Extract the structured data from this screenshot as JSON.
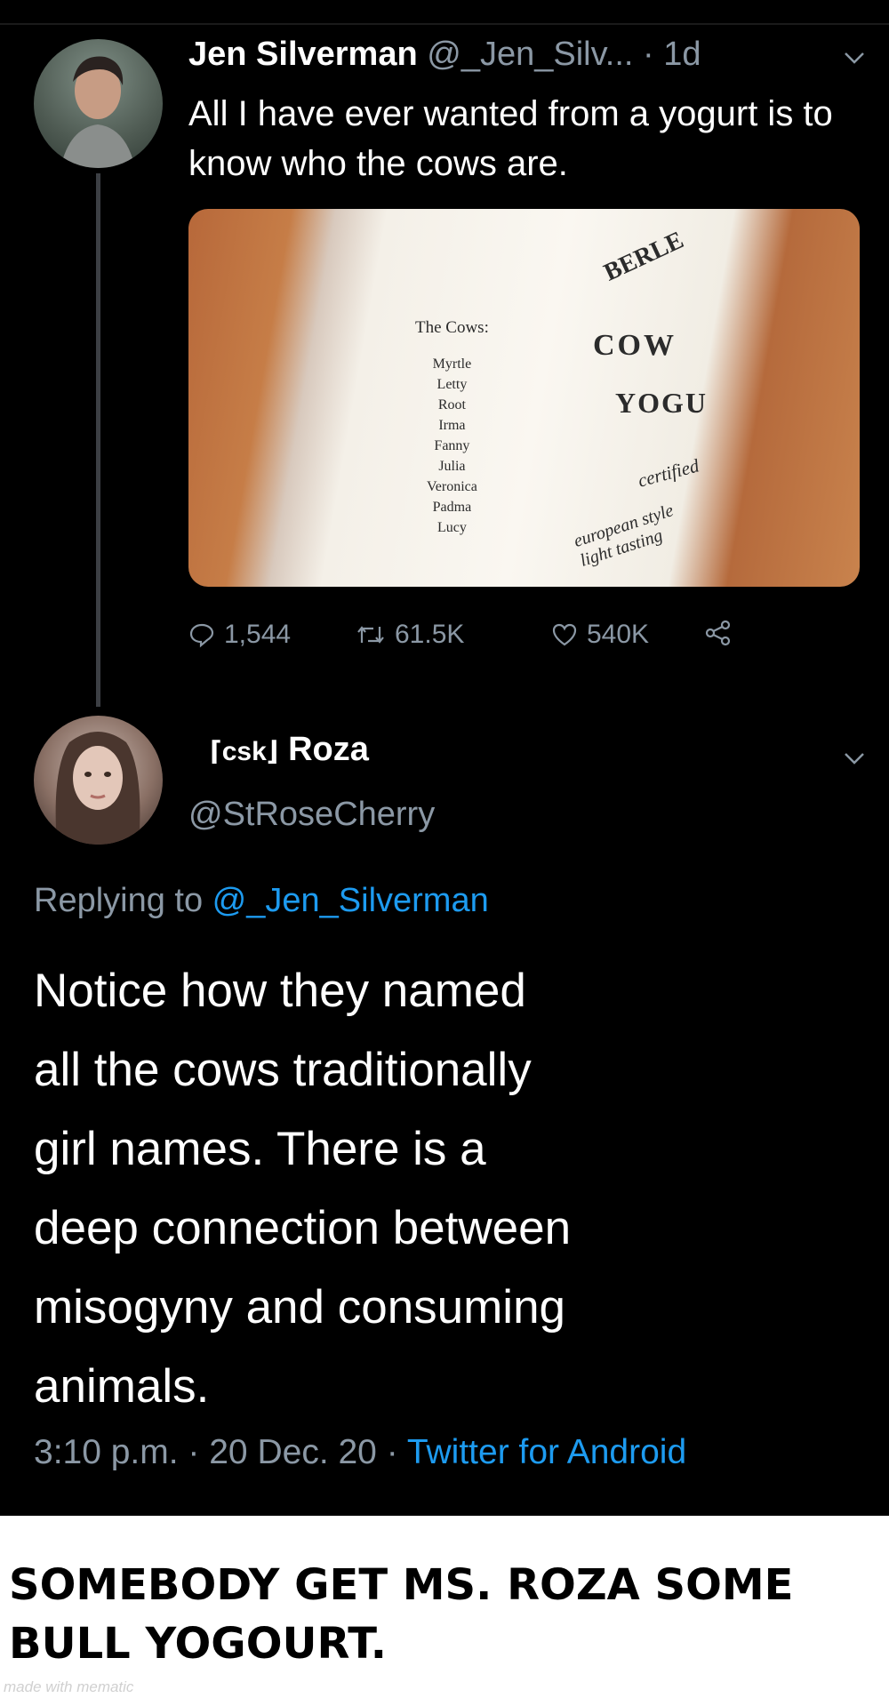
{
  "tweet1": {
    "name": "Jen Silverman",
    "handle": "@_Jen_Silv...",
    "time": "· 1d",
    "text": "All I have ever wanted from a yogurt is to know who the cows are.",
    "image": {
      "list_title": "The Cows:",
      "cow_names": [
        "Myrtle",
        "Letty",
        "Root",
        "Irma",
        "Fanny",
        "Julia",
        "Veronica",
        "Padma",
        "Lucy"
      ],
      "brand_text": "BERLE",
      "product_word_1": "COW",
      "product_word_2": "YOGU",
      "certified_text": "certified",
      "style_text": "european style",
      "tasting_text": "light tasting"
    },
    "stats": {
      "replies": "1,544",
      "retweets": "61.5K",
      "likes": "540K"
    }
  },
  "tweet2": {
    "display_tag": "csk",
    "display_name": "Roza",
    "handle": "@StRoseCherry",
    "replying_prefix": "Replying to ",
    "replying_mention": "@_Jen_Silverman",
    "text_lines": [
      "Notice how they named",
      "all the cows traditionally",
      "girl names. There is a",
      "deep connection between",
      "misogyny and consuming",
      "animals."
    ],
    "timestamp": "3:10 p.m. · 20 Dec. 20 · ",
    "source": "Twitter for Android"
  },
  "caption_lines": [
    "SOMEBODY GET MS. ROZA SOME",
    "BULL YOGOURT."
  ],
  "watermark": "made with mematic",
  "icons": [
    "chevron-down-icon",
    "reply-icon",
    "retweet-icon",
    "heart-icon",
    "share-icon"
  ],
  "colors": {
    "background": "#000000",
    "text": "#ffffff",
    "muted": "#8b98a5",
    "link": "#1d9bf0"
  }
}
